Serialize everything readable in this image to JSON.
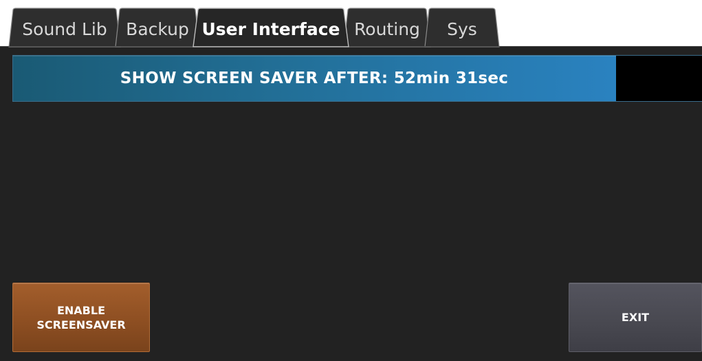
{
  "tabs": [
    {
      "label": "Sound Lib",
      "active": false
    },
    {
      "label": "Backup",
      "active": false
    },
    {
      "label": "User Interface",
      "active": true
    },
    {
      "label": "Routing",
      "active": false
    },
    {
      "label": "Sys",
      "active": false
    }
  ],
  "screen_saver": {
    "label": "SHOW SCREEN SAVER AFTER: 52min 31sec",
    "level_fraction": 0.875
  },
  "buttons": {
    "enable_label": "ENABLE\nSCREENSAVER",
    "exit_label": "EXIT"
  },
  "colors": {
    "background": "#222222",
    "tab_bar": "#ffffff",
    "tab_fill": "#2e2e2e",
    "active_tab_fill": "#262626",
    "progress_fill": "#2a82c0",
    "enable_button": "#8e4f22",
    "exit_button": "#484850"
  }
}
